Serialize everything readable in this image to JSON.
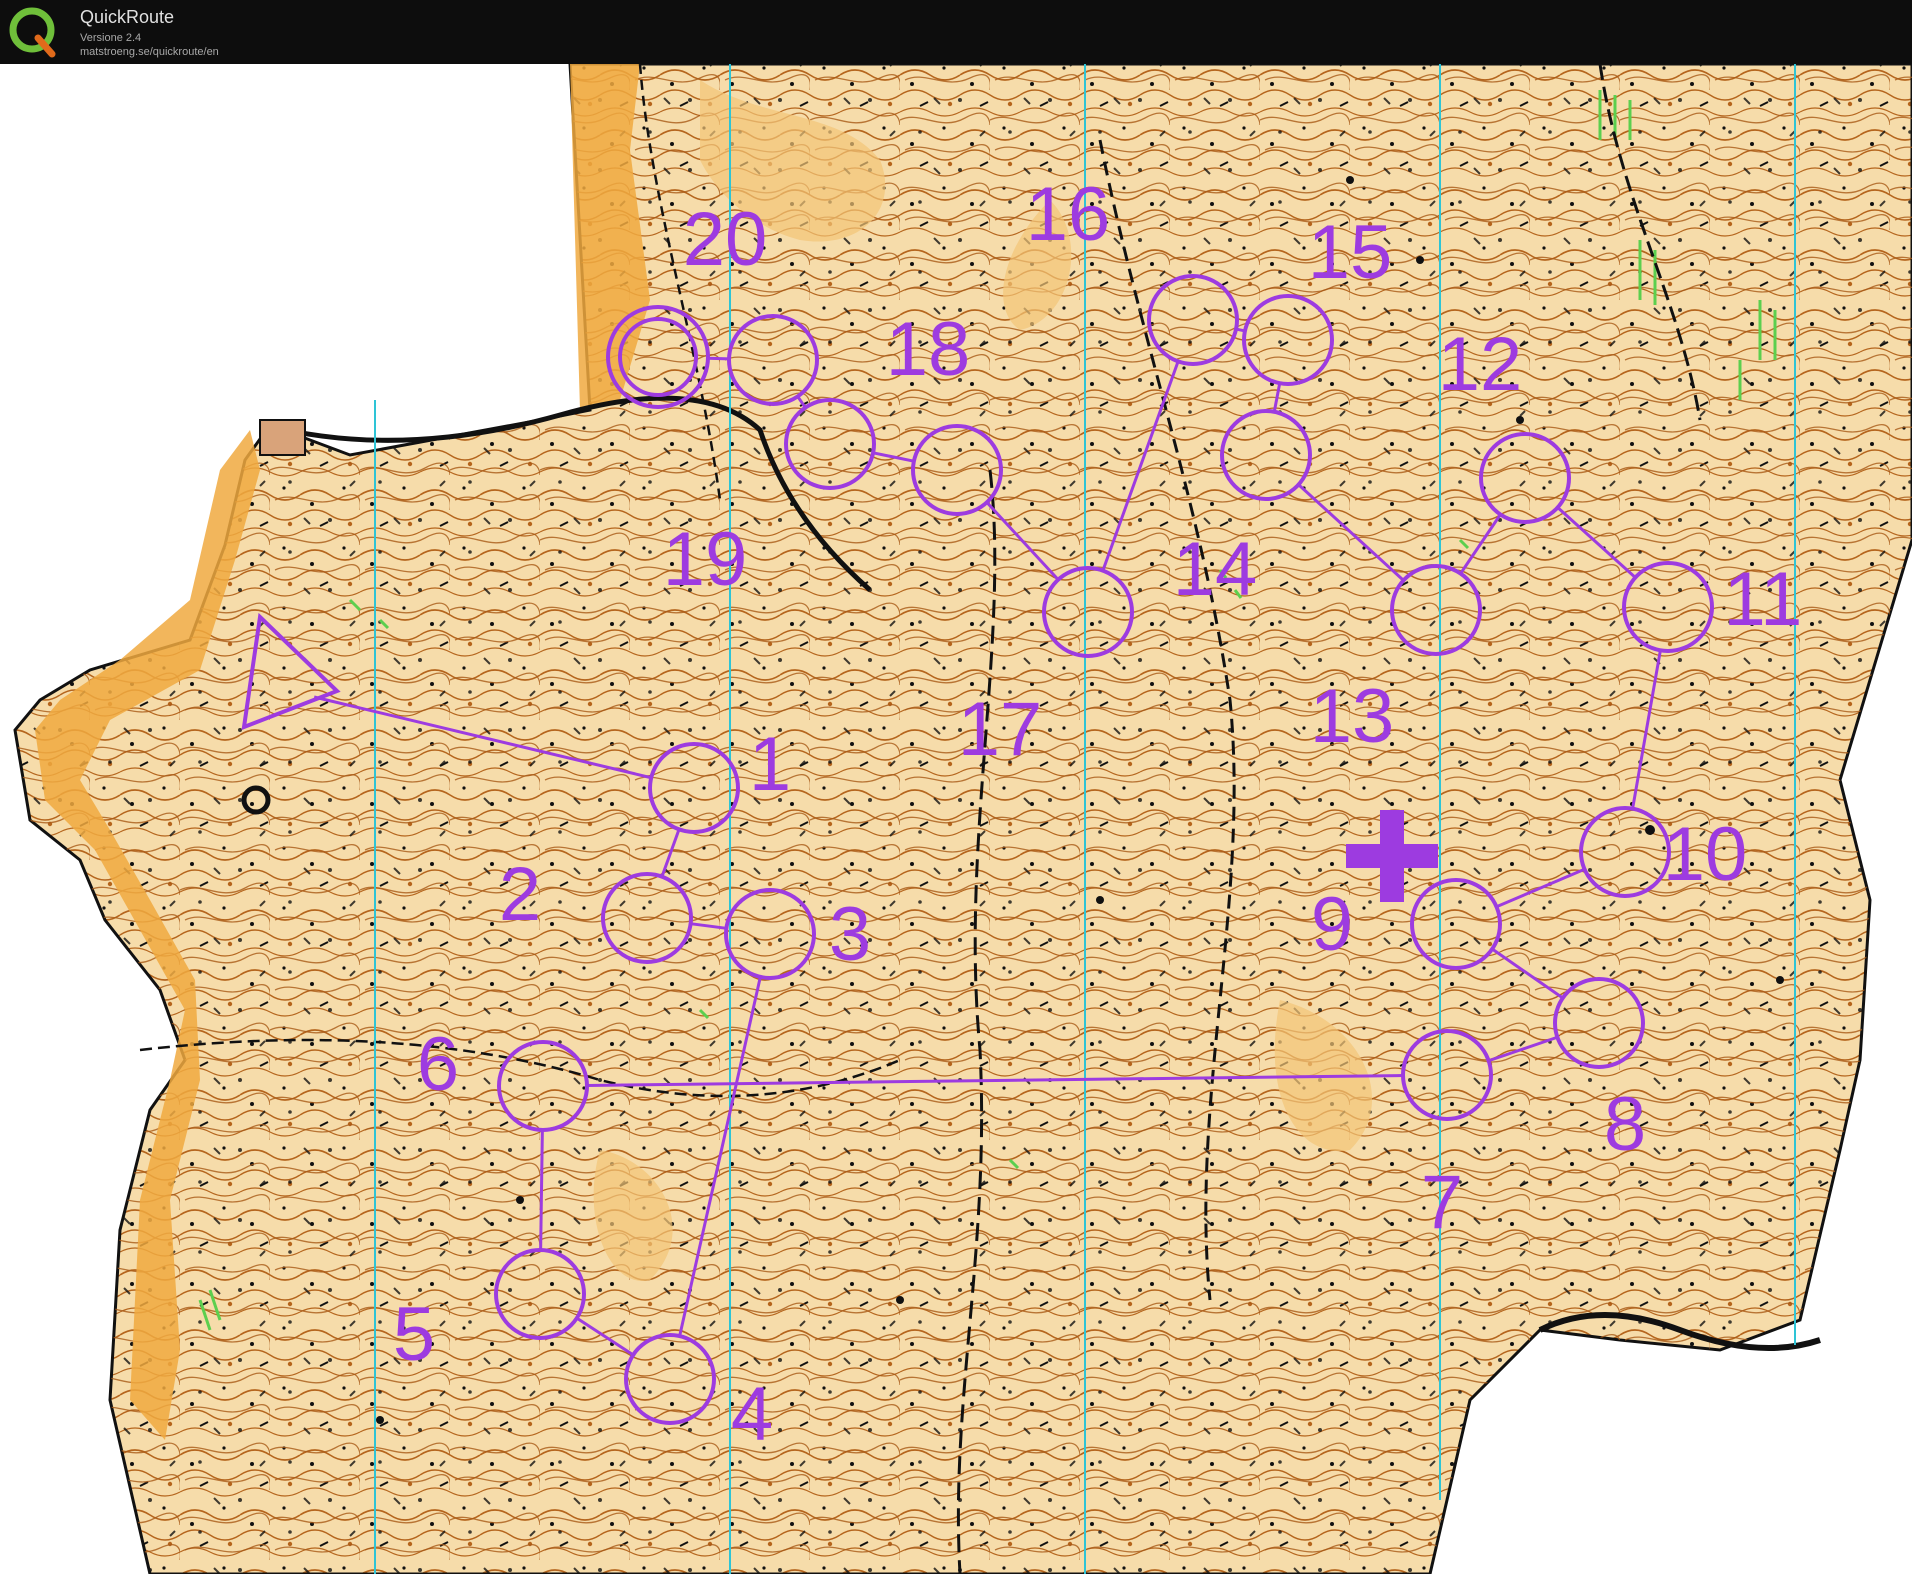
{
  "app": {
    "title": "QuickRoute",
    "version": "Versione 2.4",
    "url": "matstroeng.se/quickroute/en",
    "logo_letter": "Q",
    "logo_icon": "quickroute-logo-icon"
  },
  "colors": {
    "course": "#9d3be0",
    "terrain": "#f4d9a8",
    "terrain_open": "#f2b34f",
    "contour": "#b5651d",
    "north_lines": "#2ec4d6",
    "vegetation": "#5ccf4e",
    "titlebar": "#0d0d0d"
  },
  "course": {
    "start_icon": "start-triangle-icon",
    "finish_icon": "finish-double-circle-icon",
    "first_aid_icon": "first-aid-cross-icon",
    "controls": [
      {
        "number": "1"
      },
      {
        "number": "2"
      },
      {
        "number": "3"
      },
      {
        "number": "4"
      },
      {
        "number": "5"
      },
      {
        "number": "6"
      },
      {
        "number": "7"
      },
      {
        "number": "8"
      },
      {
        "number": "9"
      },
      {
        "number": "10"
      },
      {
        "number": "11"
      },
      {
        "number": "12"
      },
      {
        "number": "13"
      },
      {
        "number": "14"
      },
      {
        "number": "15"
      },
      {
        "number": "16"
      },
      {
        "number": "17"
      },
      {
        "number": "18"
      },
      {
        "number": "19"
      },
      {
        "number": "20"
      }
    ]
  }
}
